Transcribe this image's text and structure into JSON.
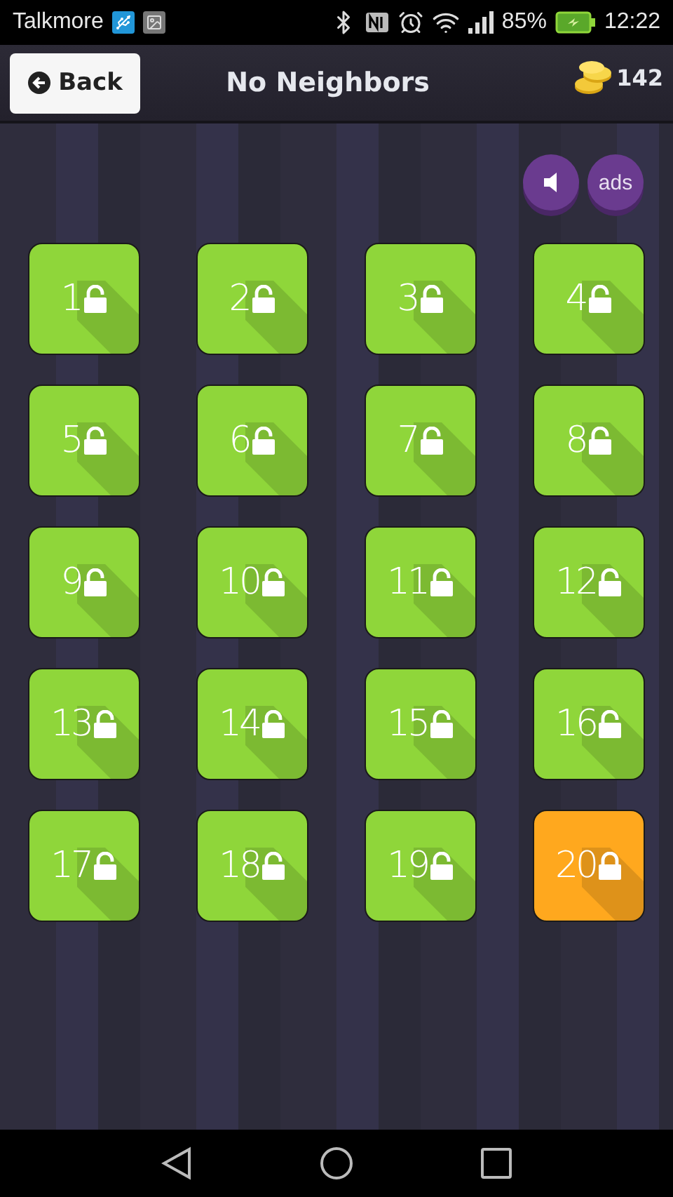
{
  "status_bar": {
    "carrier": "Talkmore",
    "battery": "85%",
    "time": "12:22"
  },
  "header": {
    "back_label": "Back",
    "title": "No Neighbors",
    "coins": "142"
  },
  "controls": {
    "ads_label": "ads"
  },
  "levels": [
    {
      "label": "1",
      "locked": false,
      "color": "#8fd63a"
    },
    {
      "label": "2",
      "locked": false,
      "color": "#8fd63a"
    },
    {
      "label": "3",
      "locked": false,
      "color": "#8fd63a"
    },
    {
      "label": "4",
      "locked": false,
      "color": "#8fd63a"
    },
    {
      "label": "5",
      "locked": false,
      "color": "#8fd63a"
    },
    {
      "label": "6",
      "locked": false,
      "color": "#8fd63a"
    },
    {
      "label": "7",
      "locked": false,
      "color": "#8fd63a"
    },
    {
      "label": "8",
      "locked": false,
      "color": "#8fd63a"
    },
    {
      "label": "9",
      "locked": false,
      "color": "#8fd63a"
    },
    {
      "label": "10",
      "locked": false,
      "color": "#8fd63a"
    },
    {
      "label": "11",
      "locked": false,
      "color": "#8fd63a"
    },
    {
      "label": "12",
      "locked": false,
      "color": "#8fd63a"
    },
    {
      "label": "13",
      "locked": false,
      "color": "#8fd63a"
    },
    {
      "label": "14",
      "locked": false,
      "color": "#8fd63a"
    },
    {
      "label": "15",
      "locked": false,
      "color": "#8fd63a"
    },
    {
      "label": "16",
      "locked": false,
      "color": "#8fd63a"
    },
    {
      "label": "17",
      "locked": false,
      "color": "#8fd63a"
    },
    {
      "label": "18",
      "locked": false,
      "color": "#8fd63a"
    },
    {
      "label": "19",
      "locked": false,
      "color": "#8fd63a"
    },
    {
      "label": "20",
      "locked": true,
      "color": "#ffa81e"
    }
  ]
}
